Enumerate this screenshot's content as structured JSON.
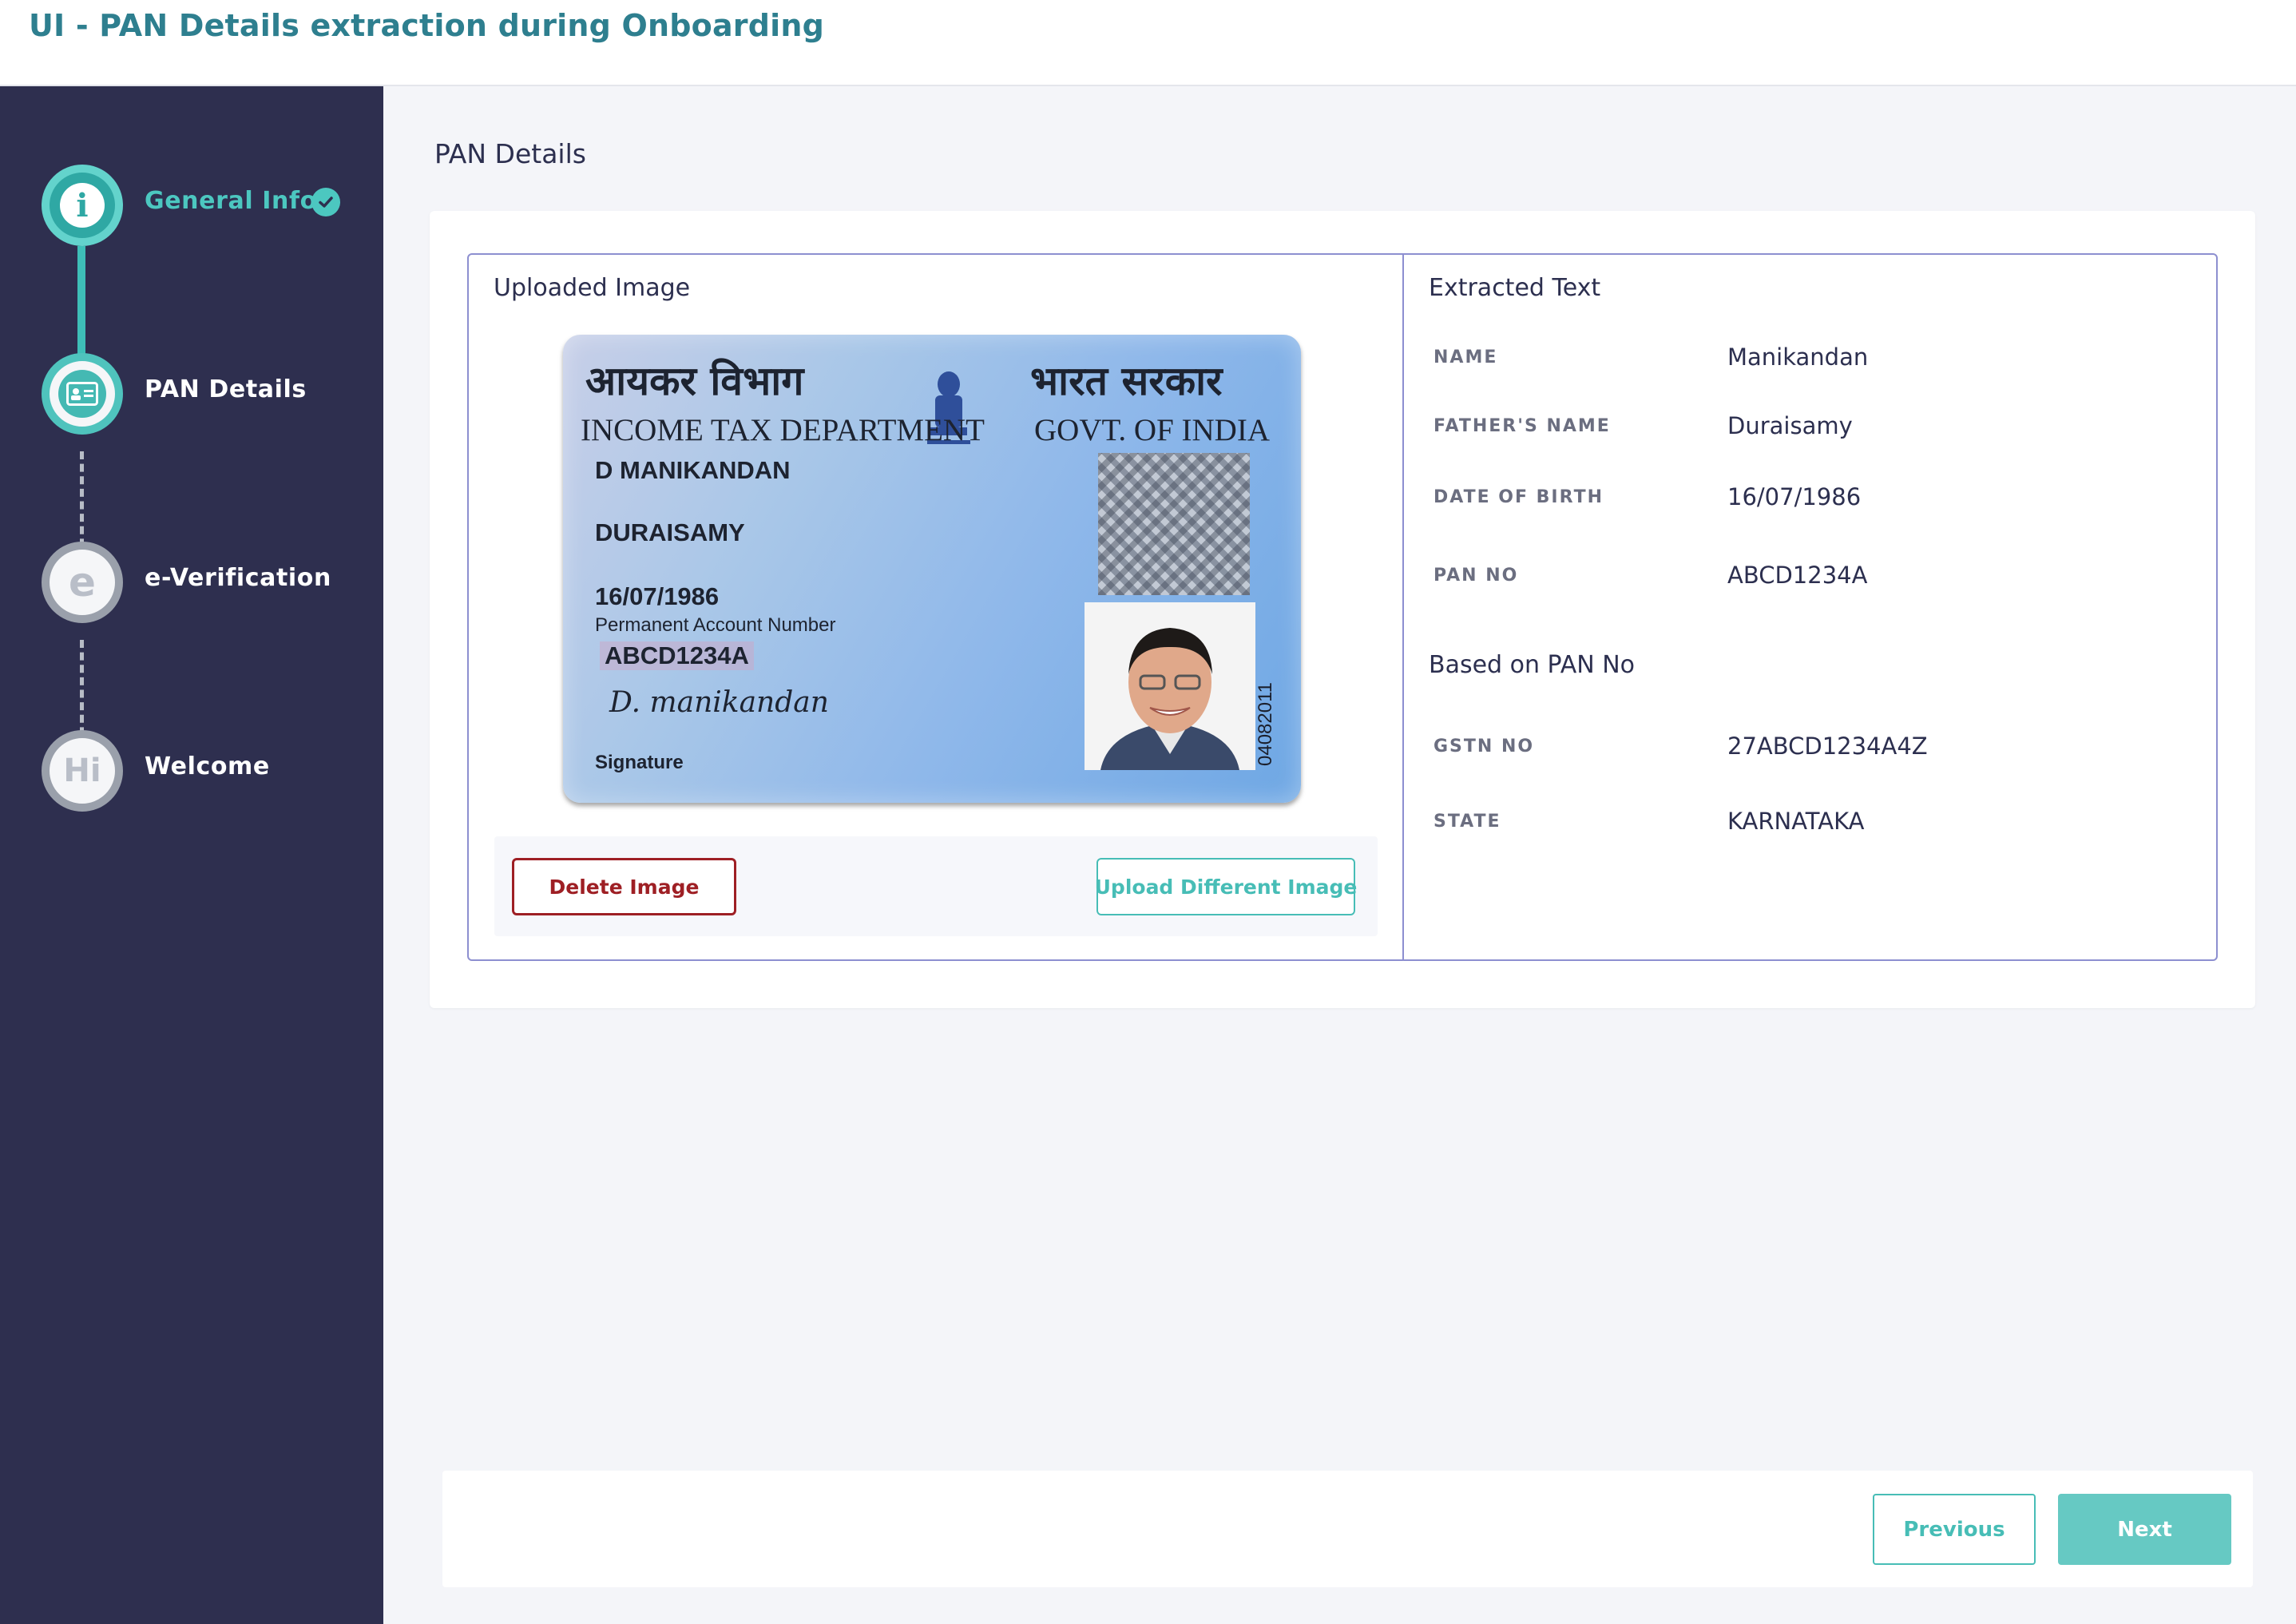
{
  "header": {
    "title": "UI - PAN Details extraction during Onboarding"
  },
  "sidebar": {
    "steps": [
      {
        "label": "General Info",
        "icon": "info-icon",
        "status": "done"
      },
      {
        "label": "PAN Details",
        "icon": "id-card-icon",
        "status": "current"
      },
      {
        "label": "e-Verification",
        "icon_letter": "e",
        "status": "pending"
      },
      {
        "label": "Welcome",
        "icon_letter": "Hi",
        "status": "pending"
      }
    ]
  },
  "main": {
    "heading": "PAN Details",
    "uploaded": {
      "title": "Uploaded Image",
      "delete_label": "Delete Image",
      "upload_label": "Upload Different Image"
    },
    "pan_card": {
      "hindi_dept": "आयकर विभाग",
      "hindi_govt": "भारत सरकार",
      "dept": "INCOME TAX DEPARTMENT",
      "govt": "GOVT. OF INDIA",
      "name": "D MANIKANDAN",
      "father": "DURAISAMY",
      "dob": "16/07/1986",
      "pan_label": "Permanent Account Number",
      "pan": "ABCD1234A",
      "signature": "D. manikandan",
      "signature_label": "Signature",
      "serial": "04082011"
    },
    "extracted": {
      "title": "Extracted Text",
      "fields": [
        {
          "label": "NAME",
          "value": "Manikandan"
        },
        {
          "label": "FATHER'S NAME",
          "value": "Duraisamy"
        },
        {
          "label": "DATE OF BIRTH",
          "value": "16/07/1986"
        },
        {
          "label": "PAN NO",
          "value": "ABCD1234A"
        }
      ],
      "based_title": "Based on PAN No",
      "based_fields": [
        {
          "label": "GSTN NO",
          "value": "27ABCD1234A4Z"
        },
        {
          "label": "STATE",
          "value": "KARNATAKA"
        }
      ]
    }
  },
  "footer": {
    "previous_label": "Previous",
    "next_label": "Next"
  },
  "colors": {
    "accent": "#47bdb6",
    "sidebar": "#2e2f4f",
    "danger": "#9e1f24",
    "header_title": "#2e7f8f"
  }
}
